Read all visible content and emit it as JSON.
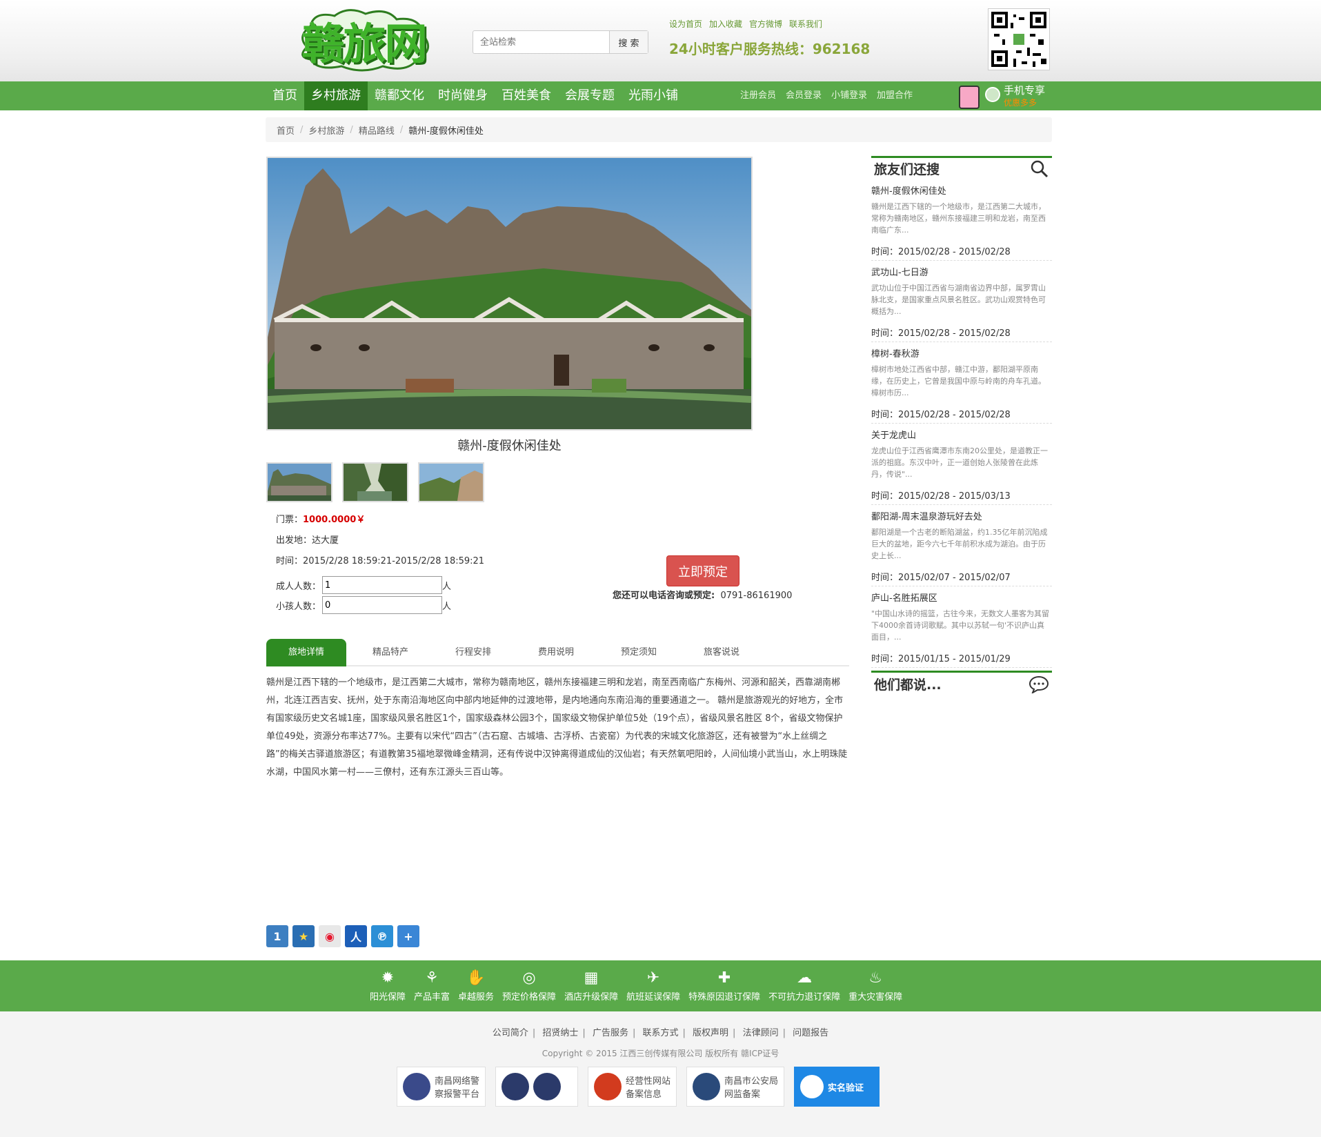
{
  "header": {
    "logo_text": "赣旅网",
    "search_placeholder": "全站检索",
    "search_button": "搜 索",
    "top_links": [
      "设为首页",
      "加入收藏",
      "官方微博",
      "联系我们"
    ],
    "hotline": "24小时客户服务热线：962168"
  },
  "nav": {
    "items": [
      "首页",
      "乡村旅游",
      "赣鄱文化",
      "时尚健身",
      "百姓美食",
      "会展专题",
      "光雨小铺"
    ],
    "active_index": 1,
    "sub_links": [
      "注册会员",
      "会员登录",
      "小铺登录",
      "加盟合作"
    ],
    "mobile_title": "手机专享",
    "mobile_sub": "优惠多多"
  },
  "breadcrumb": [
    "首页",
    "乡村旅游",
    "精品路线",
    "赣州-度假休闲佳处"
  ],
  "product": {
    "caption": "赣州-度假休闲佳处",
    "ticket_label": "门票：",
    "ticket_price": "1000.0000￥",
    "departure_label": "出发地：",
    "departure": "达大厦",
    "time_label": "时间：",
    "time": "2015/2/28 18:59:21-2015/2/28 18:59:21",
    "adult_label": "成人人数：",
    "adult_value": "1",
    "child_label": "小孩人数：",
    "child_value": "0",
    "unit": "人",
    "book_button": "立即预定",
    "phone_label": "您还可以电话咨询或预定:",
    "phone": "0791-86161900"
  },
  "tabs": [
    "旅地详情",
    "精品特产",
    "行程安排",
    "费用说明",
    "预定须知",
    "旅客说说"
  ],
  "tab_content": "赣州是江西下辖的一个地级市，是江西第二大城市，常称为赣南地区，赣州东接福建三明和龙岩，南至西南临广东梅州、河源和韶关，西靠湖南郴州，北连江西吉安、抚州，处于东南沿海地区向中部内地延伸的过渡地带，是内地通向东南沿海的重要通道之一。 赣州是旅游观光的好地方，全市有国家级历史文名城1座，国家级风景名胜区1个，国家级森林公园3个，国家级文物保护单位5处（19个点），省级风景名胜区 8个，省级文物保护单位49处，资源分布率达77%。主要有以宋代“四古”（古石窟、古城墙、古浮桥、古瓷窑）为代表的宋城文化旅游区，还有被誉为“水上丝绸之路”的梅关古驿道旅游区；有道教第35福地翠微峰金精洞，还有传说中汉钟离得道成仙的汉仙岩；有天然氧吧阳岭，人间仙境小武当山，水上明珠陡水湖，中国风水第一村——三僚村，还有东江源头三百山等。",
  "sidebar": {
    "title": "旅友们还搜",
    "items": [
      {
        "title": "赣州-度假休闲佳处",
        "desc": "赣州是江西下辖的一个地级市，是江西第二大城市，常称为赣南地区，赣州东接福建三明和龙岩，南至西南临广东...",
        "time": "时间：2015/02/28 - 2015/02/28"
      },
      {
        "title": "武功山-七日游",
        "desc": "武功山位于中国江西省与湖南省边界中部，属罗霄山脉北支，是国家重点风景名胜区。武功山观赏特色可概括为...",
        "time": "时间：2015/02/28 - 2015/02/28"
      },
      {
        "title": "樟树-春秋游",
        "desc": "樟树市地处江西省中部，赣江中游，鄱阳湖平原南缘，在历史上，它曾是我国中原与岭南的舟车孔道。樟树市历...",
        "time": "时间：2015/02/28 - 2015/02/28"
      },
      {
        "title": "关于龙虎山",
        "desc": "龙虎山位于江西省鹰潭市东南20公里处，是道教正一派的祖庭。东汉中叶，正一道创始人张陵曾在此炼丹，传说\"...",
        "time": "时间：2015/02/28 - 2015/03/13"
      },
      {
        "title": "鄱阳湖-周末温泉游玩好去处",
        "desc": "鄱阳湖是一个古老的断陷湖盆，约1.35亿年前沉陷成巨大的盆地，距今六七千年前积水成为湖泊。由于历史上长...",
        "time": "时间：2015/02/07 - 2015/02/07"
      },
      {
        "title": "庐山-名胜拓展区",
        "desc": "\"中国山水诗的摇篮，古往今来，无数文人墨客为其留下4000余首诗词歌赋。其中以苏轼一句'不识庐山真面目，...",
        "time": "时间：2015/01/15 - 2015/01/29"
      }
    ],
    "they_say": "他们都说..."
  },
  "guarantees": [
    "阳光保障",
    "产品丰富",
    "卓越服务",
    "预定价格保障",
    "酒店升级保障",
    "航班延误保障",
    "特殊原因退订保障",
    "不可抗力退订保障",
    "重大灾害保障"
  ],
  "footer": {
    "links": [
      "公司简介",
      "招贤纳士",
      "广告服务",
      "联系方式",
      "版权声明",
      "法律顾问",
      "问题报告"
    ],
    "copyright": "Copyright © 2015 江西三创传媒有限公司 版权所有 赣ICP证号",
    "badges": [
      {
        "line1": "南昌网络警",
        "line2": "察报警平台"
      },
      {
        "line1": "",
        "line2": ""
      },
      {
        "line1": "经营性网站",
        "line2": "备案信息"
      },
      {
        "line1": "南昌市公安局",
        "line2": "网监备案"
      },
      {
        "line1": "实名验证",
        "line2": ""
      }
    ]
  }
}
